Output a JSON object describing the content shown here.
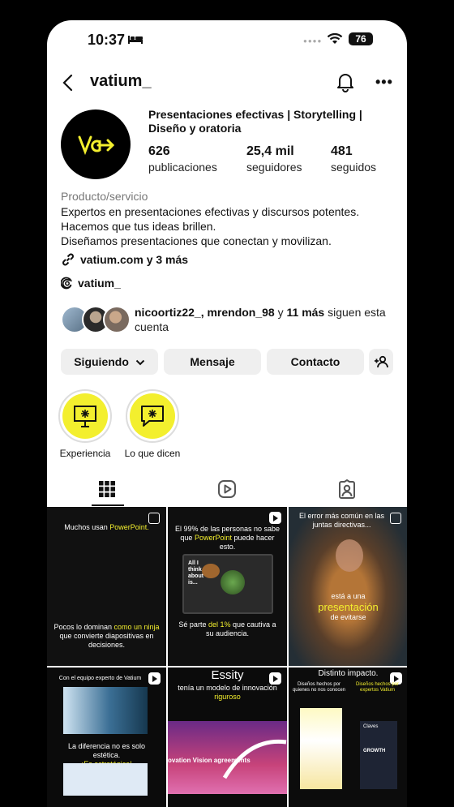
{
  "status": {
    "time": "10:37",
    "battery": "76"
  },
  "header": {
    "username": "vatium_"
  },
  "profile": {
    "name": "Presentaciones efectivas | Storytelling | Diseño y oratoria",
    "stats": [
      {
        "value": "626",
        "label": "publicaciones"
      },
      {
        "value": "25,4 mil",
        "label": "seguidores"
      },
      {
        "value": "481",
        "label": "seguidos"
      }
    ],
    "category": "Producto/servicio",
    "bio": [
      "Expertos en presentaciones efectivas y discursos potentes.",
      "Hacemos que tus ideas brillen.",
      "Diseñamos presentaciones que conectan y movilizan."
    ],
    "link": "vatium.com y 3 más",
    "threads": "vatium_",
    "followed_by": {
      "names": "nicoortiz22_, mrendon_98",
      "and": " y ",
      "more": "11 más",
      "rest": " siguen esta cuenta"
    }
  },
  "buttons": {
    "following": "Siguiendo",
    "message": "Mensaje",
    "contact": "Contacto"
  },
  "highlights": [
    {
      "label": "Experiencia"
    },
    {
      "label": "Lo que dicen"
    }
  ],
  "tabs": [
    "posts-grid",
    "reels",
    "tagged"
  ],
  "posts": [
    {
      "top": "Muchos usan",
      "top_hl": "PowerPoint.",
      "bottom_a": "Pocos lo dominan",
      "bottom_hl": "como un ninja",
      "bottom_b": "que convierte diapositivas en decisiones."
    },
    {
      "top": "El 99% de las personas no sabe que",
      "top_hl": "PowerPoint",
      "top_b": "puede hacer esto.",
      "card": "All I think about is...",
      "bottom_a": "Sé parte",
      "bottom_hl": "del 1%",
      "bottom_b": "que cautiva a su audiencia."
    },
    {
      "top": "El error más común en las juntas directivas...",
      "mid": "está a una",
      "mid_hl": "presentación",
      "mid_b": "de evitarse"
    },
    {
      "top": "Con el equipo experto de Vatium",
      "mid": "La diferencia no es solo estética.",
      "mid_hl": "¡Es estratégica!"
    },
    {
      "top_big": "Essity",
      "top": "tenía un modelo de innovación",
      "top_hl": "riguroso",
      "banner": "ovation Vision agreements"
    },
    {
      "top_hl": "Distinto impacto.",
      "left": "Diseños hechos por quienes no nos conocen",
      "right": "Diseños hechos por expertos Vatium",
      "card": "Claves",
      "card2": "GROWTH"
    }
  ],
  "colors": {
    "accent": "#f3ef2e",
    "background": "#ffffff",
    "button": "#efefef"
  }
}
